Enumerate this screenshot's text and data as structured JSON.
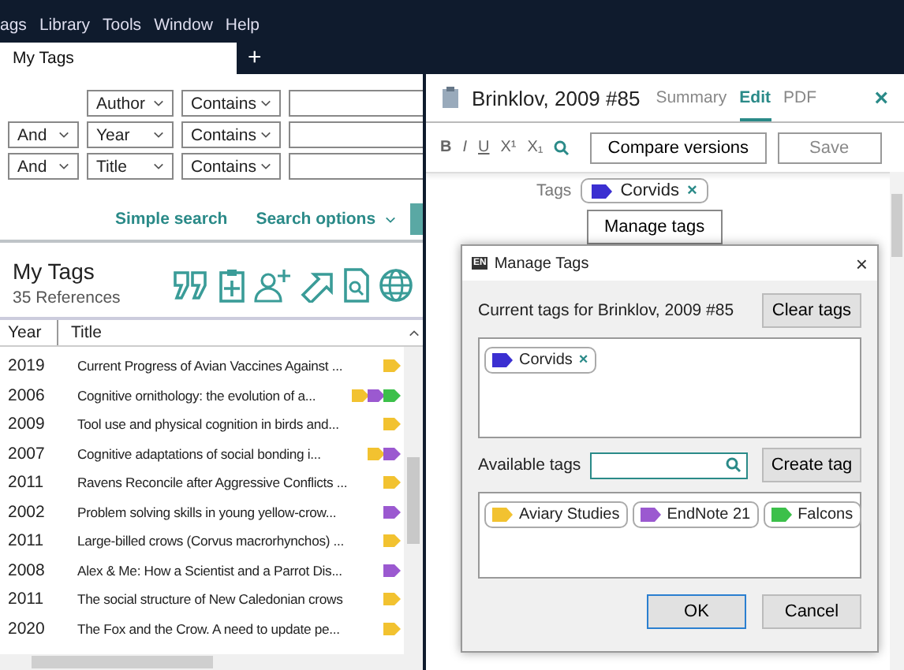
{
  "menu": [
    "ags",
    "Library",
    "Tools",
    "Window",
    "Help"
  ],
  "tabs": [
    {
      "label": "My Tags",
      "selected": true
    }
  ],
  "new_tab": "+",
  "search_rows": [
    {
      "logic": null,
      "field": "Author",
      "op": "Contains"
    },
    {
      "logic": "And",
      "field": "Year",
      "op": "Contains"
    },
    {
      "logic": "And",
      "field": "Title",
      "op": "Contains"
    }
  ],
  "search_links": {
    "simple": "Simple search",
    "options": "Search options"
  },
  "group": {
    "title": "My Tags",
    "count": "35 References"
  },
  "table": {
    "columns": [
      "Year",
      "Title"
    ],
    "rows": [
      {
        "year": "2019",
        "title": "Current Progress of Avian Vaccines Against ...",
        "tags": [
          {
            "color": "#f2c230"
          }
        ]
      },
      {
        "year": "2006",
        "title": "Cognitive ornithology: the evolution of a...",
        "tags": [
          {
            "color": "#f2c230"
          },
          {
            "color": "#9b59d0"
          },
          {
            "color": "#3cc04a"
          }
        ]
      },
      {
        "year": "2009",
        "title": "Tool use and physical cognition in birds and...",
        "tags": [
          {
            "color": "#f2c230"
          }
        ]
      },
      {
        "year": "2007",
        "title": "Cognitive adaptations of social bonding i...",
        "tags": [
          {
            "color": "#f2c230"
          },
          {
            "color": "#9b59d0"
          }
        ]
      },
      {
        "year": "2011",
        "title": "Ravens Reconcile after Aggressive Conflicts ...",
        "tags": [
          {
            "color": "#f2c230"
          }
        ]
      },
      {
        "year": "2002",
        "title": "Problem solving skills in young yellow-crow...",
        "tags": [
          {
            "color": "#9b59d0"
          }
        ]
      },
      {
        "year": "2011",
        "title": "Large-billed crows (Corvus macrorhynchos) ...",
        "tags": [
          {
            "color": "#f2c230"
          }
        ]
      },
      {
        "year": "2008",
        "title": "Alex & Me: How a Scientist and a Parrot Dis...",
        "tags": [
          {
            "color": "#9b59d0"
          }
        ]
      },
      {
        "year": "2011",
        "title": "The social structure of New Caledonian crows",
        "tags": [
          {
            "color": "#f2c230"
          }
        ]
      },
      {
        "year": "2020",
        "title": "The Fox and the Crow. A need to update pe...",
        "tags": [
          {
            "color": "#f2c230"
          }
        ]
      }
    ]
  },
  "reference": {
    "title": "Brinklov, 2009 #85",
    "tabs": [
      {
        "label": "Summary",
        "selected": false
      },
      {
        "label": "Edit",
        "selected": true
      },
      {
        "label": "PDF",
        "selected": false
      }
    ],
    "close": "×",
    "format_buttons": [
      "B",
      "I",
      "U",
      "X¹",
      "X₁"
    ],
    "compare": "Compare versions",
    "save": "Save",
    "tags_label": "Tags",
    "tags": [
      {
        "name": "Corvids",
        "color": "#3b2fd1"
      }
    ],
    "remove": "×",
    "manage": "Manage tags"
  },
  "dialog": {
    "logo": "EN",
    "title": "Manage Tags",
    "close": "×",
    "current_label": "Current tags for Brinklov, 2009 #85",
    "clear": "Clear tags",
    "current_tags": [
      {
        "name": "Corvids",
        "color": "#3b2fd1"
      }
    ],
    "remove": "×",
    "available_label": "Available tags",
    "create": "Create tag",
    "available_tags": [
      {
        "name": "Aviary Studies",
        "color": "#f2c230"
      },
      {
        "name": "EndNote 21",
        "color": "#9b59d0"
      },
      {
        "name": "Falcons",
        "color": "#3cc04a"
      }
    ],
    "ok": "OK",
    "cancel": "Cancel"
  }
}
